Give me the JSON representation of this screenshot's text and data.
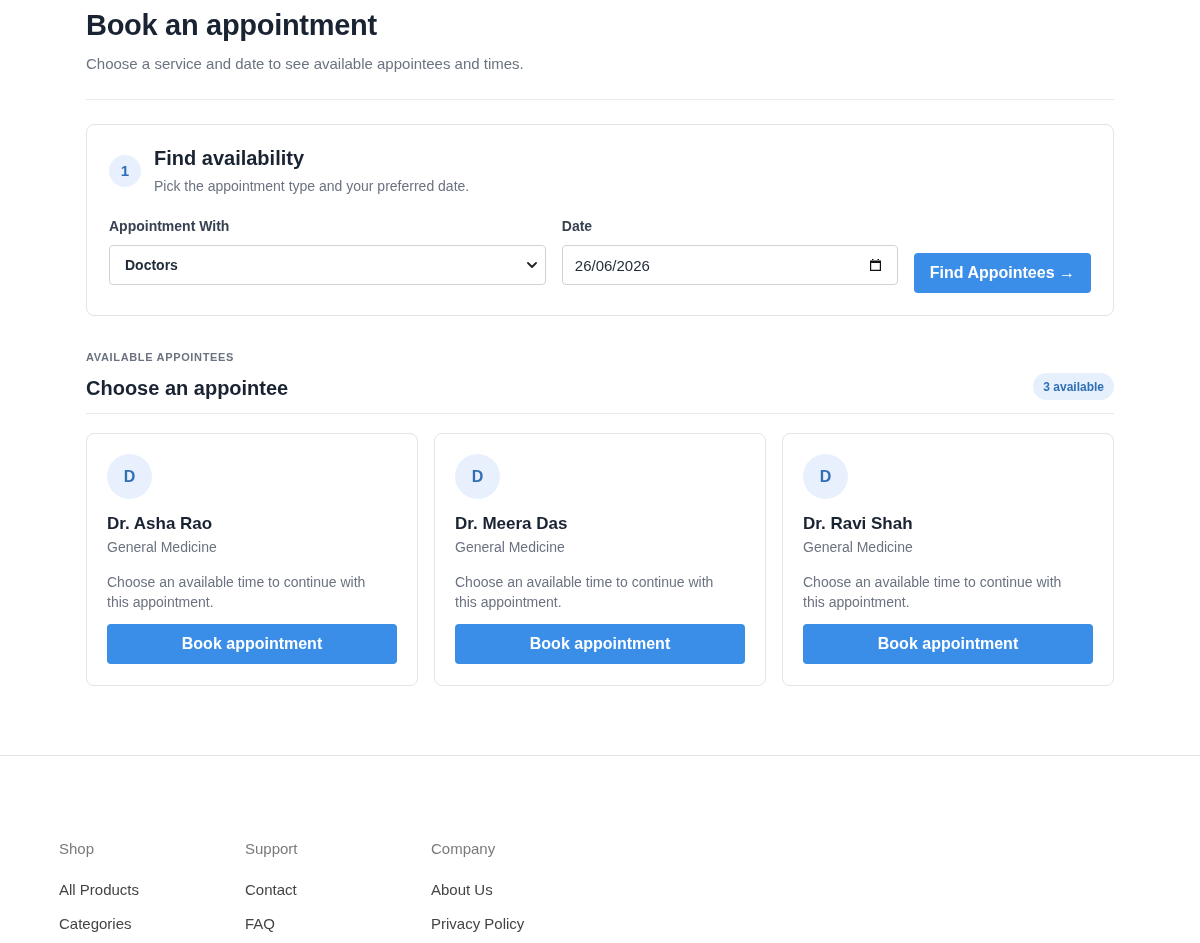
{
  "page": {
    "title": "Book an appointment",
    "subtitle": "Choose a service and date to see available appointees and times."
  },
  "search_card": {
    "step": "1",
    "title": "Find availability",
    "subtitle": "Pick the appointment type and your preferred date.",
    "fields": [
      {
        "kind": "select",
        "label": "Appointment With",
        "value": "Doctors"
      },
      {
        "kind": "date",
        "label": "Date",
        "value": "26/06/2026"
      }
    ],
    "button": "Find Appointees →"
  },
  "results": {
    "eyebrow": "AVAILABLE APPOINTEES",
    "title": "Choose an appointee",
    "badge": "3 available",
    "appointees": [
      {
        "initial": "D",
        "name": "Dr. Asha Rao",
        "specialty": "General Medicine",
        "note": "Choose an available time to continue with this appointment.",
        "button": "Book appointment"
      },
      {
        "initial": "D",
        "name": "Dr. Meera Das",
        "specialty": "General Medicine",
        "note": "Choose an available time to continue with this appointment.",
        "button": "Book appointment"
      },
      {
        "initial": "D",
        "name": "Dr. Ravi Shah",
        "specialty": "General Medicine",
        "note": "Choose an available time to continue with this appointment.",
        "button": "Book appointment"
      }
    ]
  },
  "footer": {
    "columns": [
      {
        "heading": "Shop",
        "links": [
          "All Products",
          "Categories"
        ]
      },
      {
        "heading": "Support",
        "links": [
          "Contact",
          "FAQ"
        ]
      },
      {
        "heading": "Company",
        "links": [
          "About Us",
          "Privacy Policy"
        ]
      }
    ]
  }
}
